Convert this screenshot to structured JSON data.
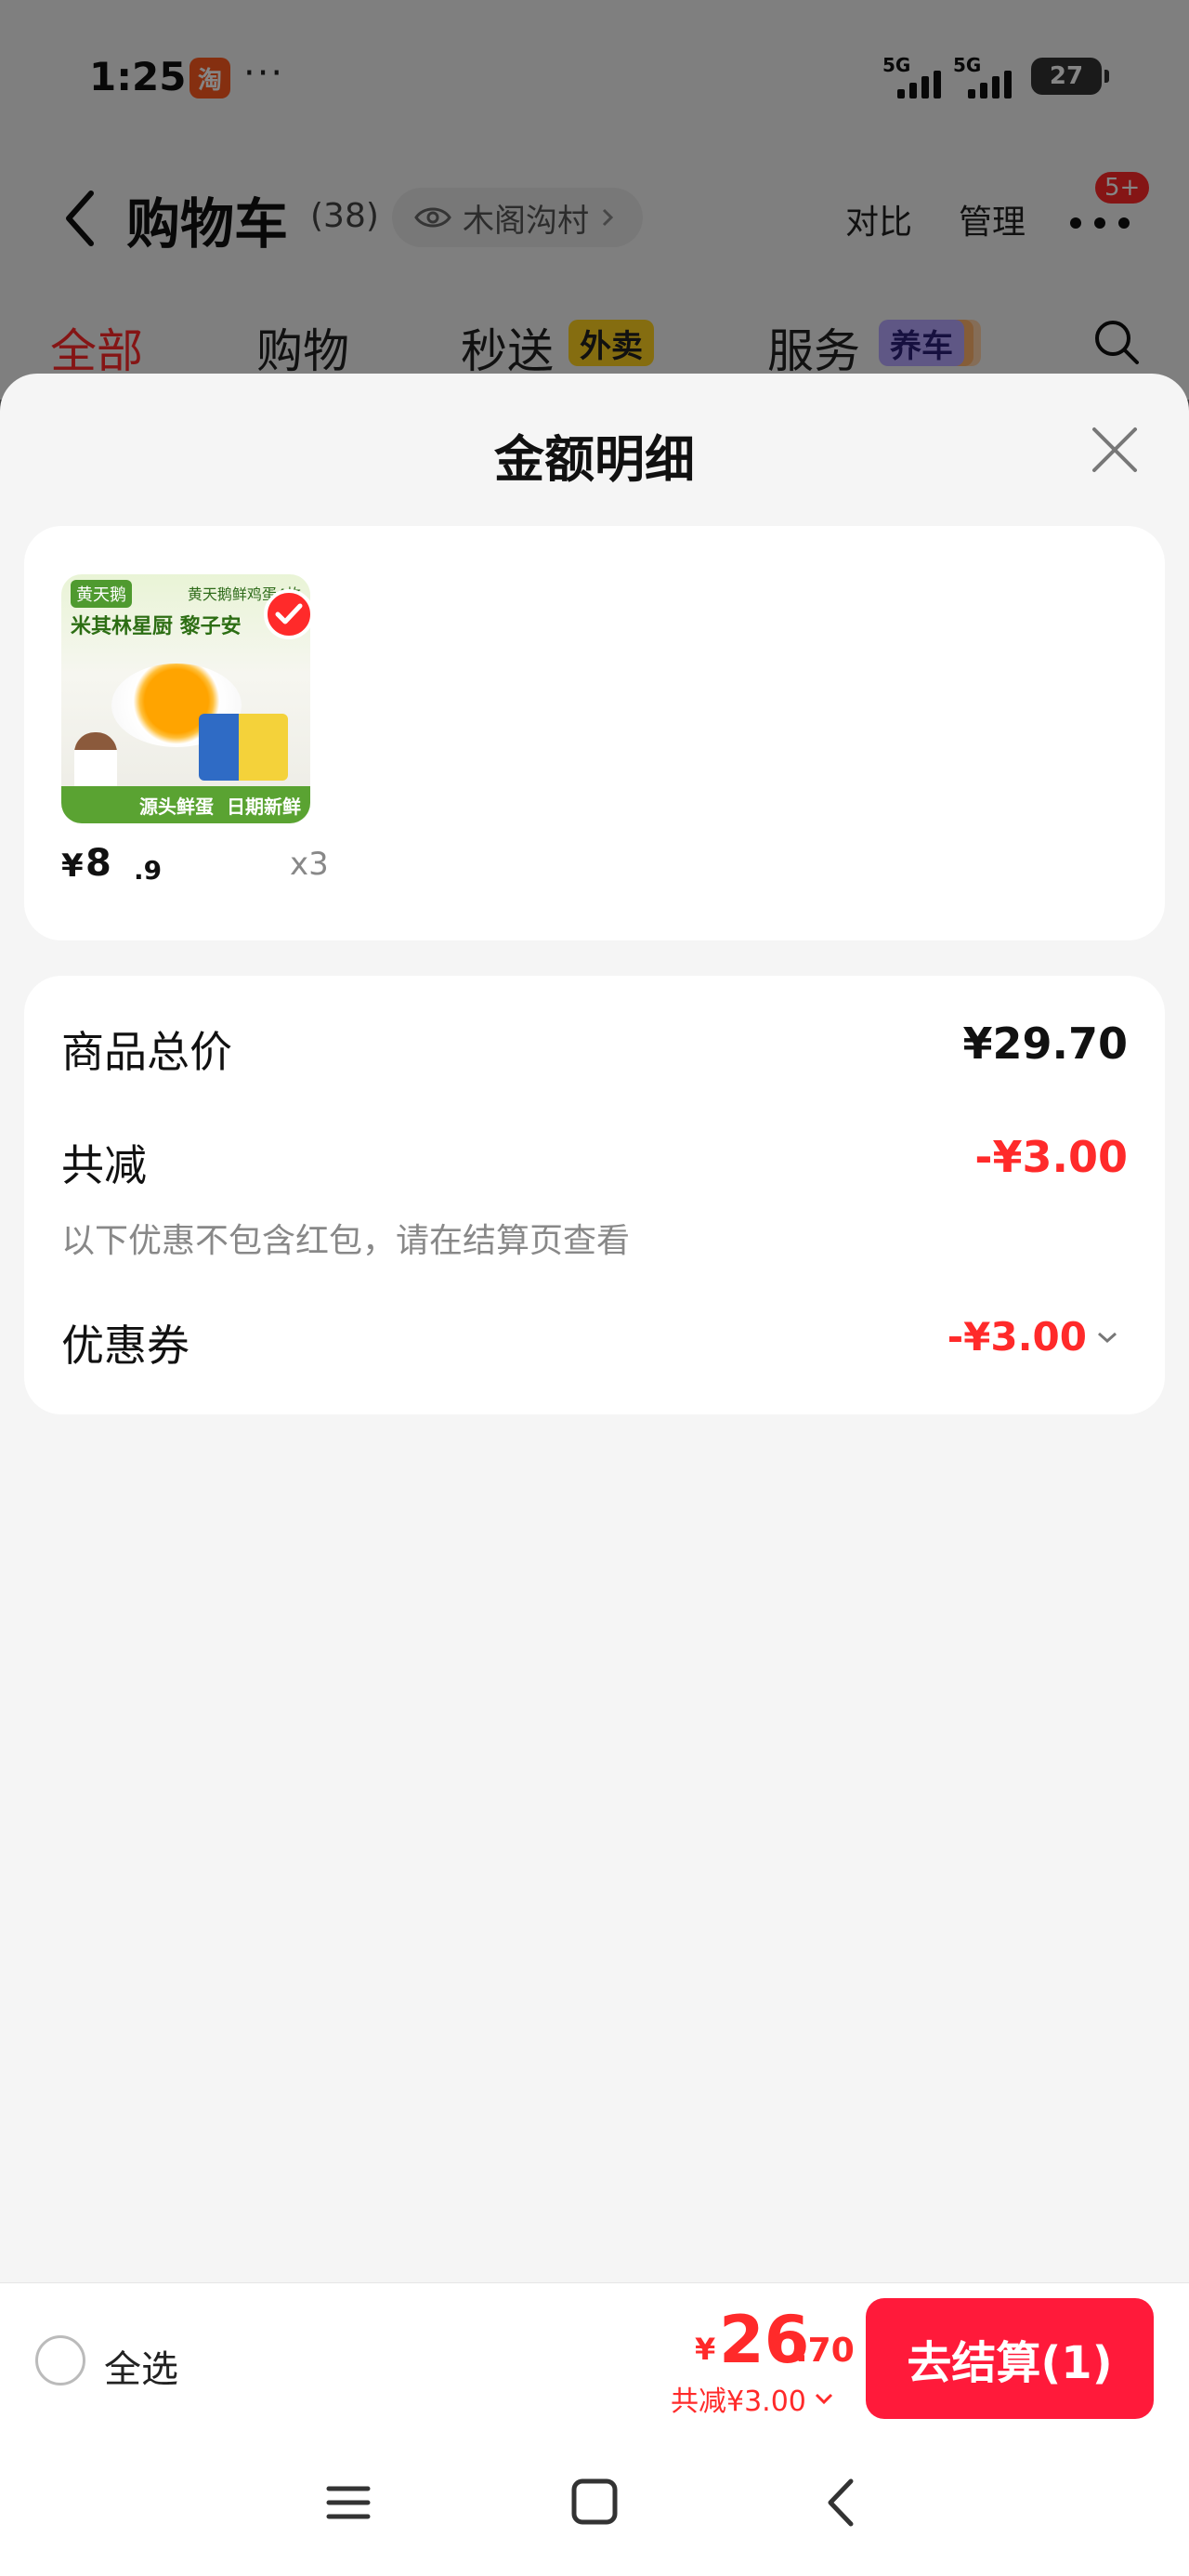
{
  "status_bar": {
    "time": "1:25",
    "app_badge": "淘",
    "dots": "···",
    "signal_1": "5G",
    "signal_2": "5G",
    "battery": "27"
  },
  "nav": {
    "title": "购物车",
    "count": "(38)",
    "location": "木阁沟村",
    "compare": "对比",
    "manage": "管理",
    "more_badge": "5+"
  },
  "tabs": [
    {
      "label": "全部",
      "active": true
    },
    {
      "label": "购物"
    },
    {
      "label": "秒送",
      "tag": "外卖"
    },
    {
      "label": "服务",
      "tag": "养车"
    }
  ],
  "sheet": {
    "title": "金额明细",
    "product": {
      "image_text": {
        "brand": "黄天鹅",
        "top_right": "黄天鹅鲜鸡蛋4枚",
        "headline": "米其林星厨  黎子安",
        "banner_left": "源头鲜蛋",
        "banner_right": "日期新鲜"
      },
      "price_symbol": "¥",
      "price_int": "8",
      "price_dec": ".9",
      "quantity": "x3"
    },
    "summary": {
      "total_label": "商品总价",
      "total_value": "¥29.70",
      "discount_label": "共减",
      "discount_value": "-¥3.00",
      "note": "以下优惠不包含红包，请在结算页查看",
      "coupon_label": "优惠券",
      "coupon_value": "-¥3.00"
    }
  },
  "checkout": {
    "select_all": "全选",
    "total_symbol": "¥",
    "total_int": "26",
    "total_dec": ".70",
    "total_discount": "共减¥3.00",
    "button": "去结算(1)"
  },
  "colors": {
    "accent_red": "#ff2a2a",
    "checkout_button": "#ff1a3a",
    "tag_yellow": "#ffd21f",
    "tag_purple": "#b7a8ff"
  }
}
